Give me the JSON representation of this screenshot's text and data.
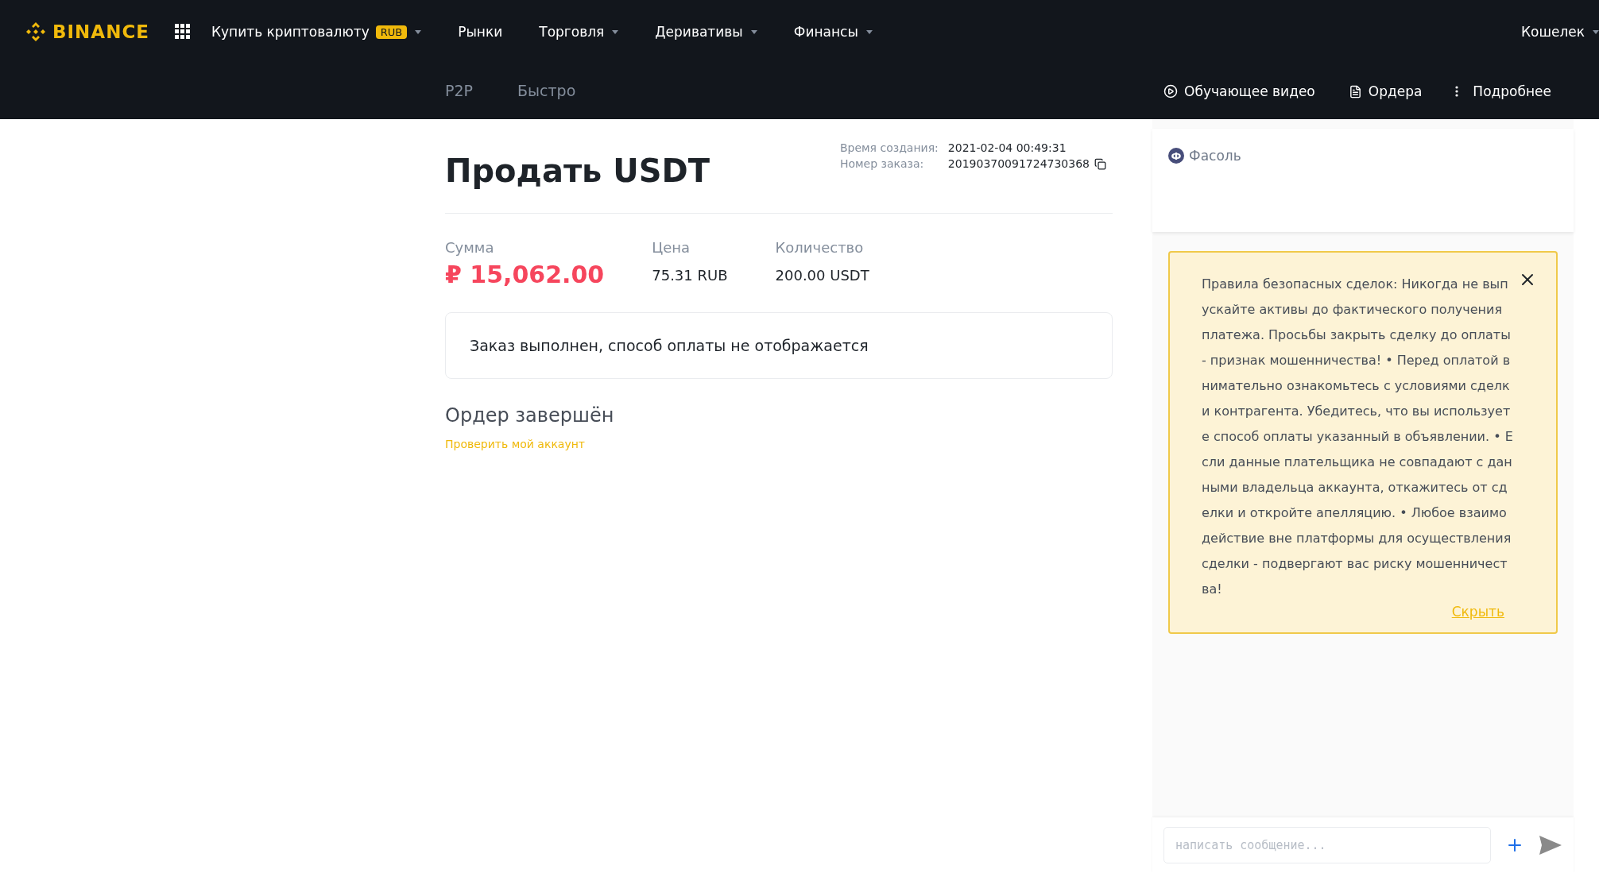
{
  "header": {
    "logo": "BINANCE",
    "nav": [
      {
        "label": "Купить криптовалюту",
        "badge": "RUB",
        "dropdown": true
      },
      {
        "label": "Рынки",
        "dropdown": false
      },
      {
        "label": "Торговля",
        "dropdown": true
      },
      {
        "label": "Деривативы",
        "dropdown": true
      },
      {
        "label": "Финансы",
        "dropdown": true
      }
    ],
    "wallet": {
      "label": "Кошелек",
      "dropdown": true
    },
    "subtabs": [
      {
        "label": "P2P",
        "selected": false
      },
      {
        "label": "Быстро",
        "selected": false
      }
    ],
    "actions": [
      {
        "kind": "video",
        "label": "Обучающее видео"
      },
      {
        "kind": "orders",
        "label": "Ордера"
      },
      {
        "kind": "more",
        "label": "Подробнее"
      }
    ]
  },
  "order": {
    "title": "Продать USDT",
    "created_label": "Время создания:",
    "created_value": "2021-02-04 00:49:31",
    "number_label": "Номер заказа:",
    "number_value": "20190370091724730368",
    "stats": [
      {
        "label": "Сумма",
        "value": "₽ 15,062.00",
        "kind": "amount"
      },
      {
        "label": "Цена",
        "value": "75.31 RUB",
        "kind": "plain"
      },
      {
        "label": "Количество",
        "value": "200.00 USDT",
        "kind": "plain"
      }
    ],
    "notice": "Заказ выполнен, способ оплаты не отображается",
    "status": "Ордер завершён",
    "link": "Проверить мой аккаунт"
  },
  "chat": {
    "counterparty": {
      "initial": "Ф",
      "name": "Фасоль"
    },
    "warning": {
      "text": "Правила безопасных сделок: Никогда не выпускайте активы до фактического получения платежа. Просьбы закрыть сделку до оплаты - признак мошенничества! • Перед оплатой внимательно ознакомьтесь с условиями сделки контрагента. Убедитесь, что вы используете способ оплаты указанный в объявлении. • Если данные плательщика не совпадают с данными владельца аккаунта, откажитесь от сделки и откройте апелляцию. • Любое взаимодействие вне платформы для осуществления сделки - подвергают вас риску мошенничества!",
      "hide": "Скрыть"
    },
    "input": {
      "placeholder": "написать сообщение..."
    }
  }
}
